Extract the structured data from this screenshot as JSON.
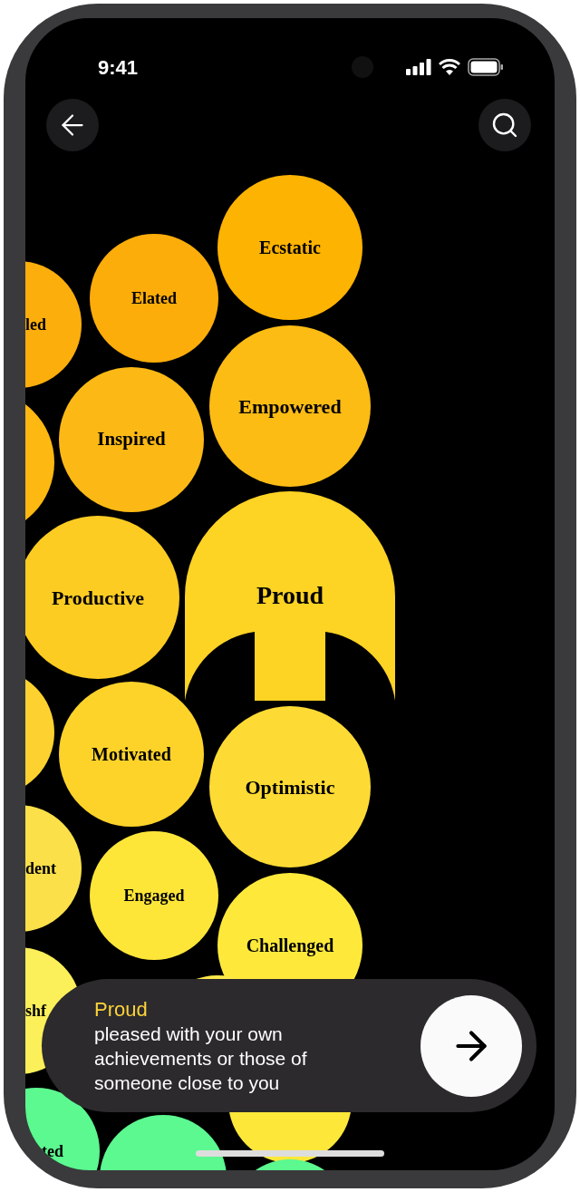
{
  "status_bar": {
    "time": "9:41"
  },
  "bubbles": [
    {
      "label": "Ecstatic",
      "color": "#fdb302",
      "selected": false
    },
    {
      "label": "Elated",
      "color": "#fcad0a",
      "selected": false
    },
    {
      "label": "led",
      "color": "#fcae0c",
      "selected": false
    },
    {
      "label": "Empowered",
      "color": "#fdbc14",
      "selected": false
    },
    {
      "label": "Inspired",
      "color": "#fcb915",
      "selected": false
    },
    {
      "color": "#fdb812",
      "selected": false
    },
    {
      "label": "Proud",
      "color": "#fdd324",
      "selected": true
    },
    {
      "label": "Productive",
      "color": "#fdcc22",
      "selected": false
    },
    {
      "color": "#fdd230",
      "selected": false
    },
    {
      "label": "Motivated",
      "color": "#fdd32a",
      "selected": false
    },
    {
      "label": "Optimistic",
      "color": "#fddb34",
      "selected": false
    },
    {
      "label": "dent",
      "color": "#fbe04a",
      "selected": false
    },
    {
      "label": "Engaged",
      "color": "#fee639",
      "selected": false
    },
    {
      "label": "Challenged",
      "color": "#fee93b",
      "selected": false
    },
    {
      "color": "#fde94a",
      "selected": false
    },
    {
      "label": "shf",
      "color": "#fbef5a",
      "selected": false
    },
    {
      "color": "#fde83a",
      "selected": false
    },
    {
      "label": "ted",
      "color": "#5cf890",
      "selected": false
    },
    {
      "color": "#5cf890",
      "selected": false
    },
    {
      "color": "#5cf890",
      "selected": false
    }
  ],
  "detail_card": {
    "title": "Proud",
    "description": "pleased with your own achievements or those of someone close to you"
  }
}
